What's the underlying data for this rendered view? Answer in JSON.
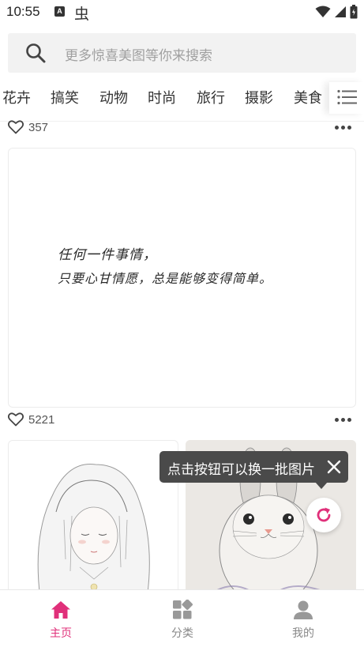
{
  "status_bar": {
    "time": "10:55",
    "a_badge": "A",
    "bug_glyph": "虫",
    "icons": [
      "wifi-icon",
      "signal-icon",
      "battery-icon"
    ]
  },
  "search": {
    "placeholder": "更多惊喜美图等你来搜索",
    "icon": "search-icon"
  },
  "categories": [
    "花卉",
    "搞笑",
    "动物",
    "时尚",
    "旅行",
    "摄影",
    "美食"
  ],
  "category_more_icon": "list-icon",
  "feed": {
    "post_top": {
      "likes": "357"
    },
    "post_quote": {
      "likes": "5221",
      "lines": [
        "任何一件事情，",
        "只要心甘情愿，总是能够变得简单。"
      ]
    }
  },
  "tooltip": {
    "text": "点击按钮可以换一批图片",
    "close_icon": "close-icon"
  },
  "refresh_icon": "refresh-icon",
  "bottom_nav": {
    "items": [
      {
        "label": "主页",
        "icon": "home-icon",
        "active": true
      },
      {
        "label": "分类",
        "icon": "category-grid-icon",
        "active": false
      },
      {
        "label": "我的",
        "icon": "user-icon",
        "active": false
      }
    ]
  },
  "colors": {
    "accent": "#e0307a",
    "tooltip_bg": "#4a4a4a",
    "search_bg": "#f2f2f2",
    "nav_inactive": "#888888"
  }
}
